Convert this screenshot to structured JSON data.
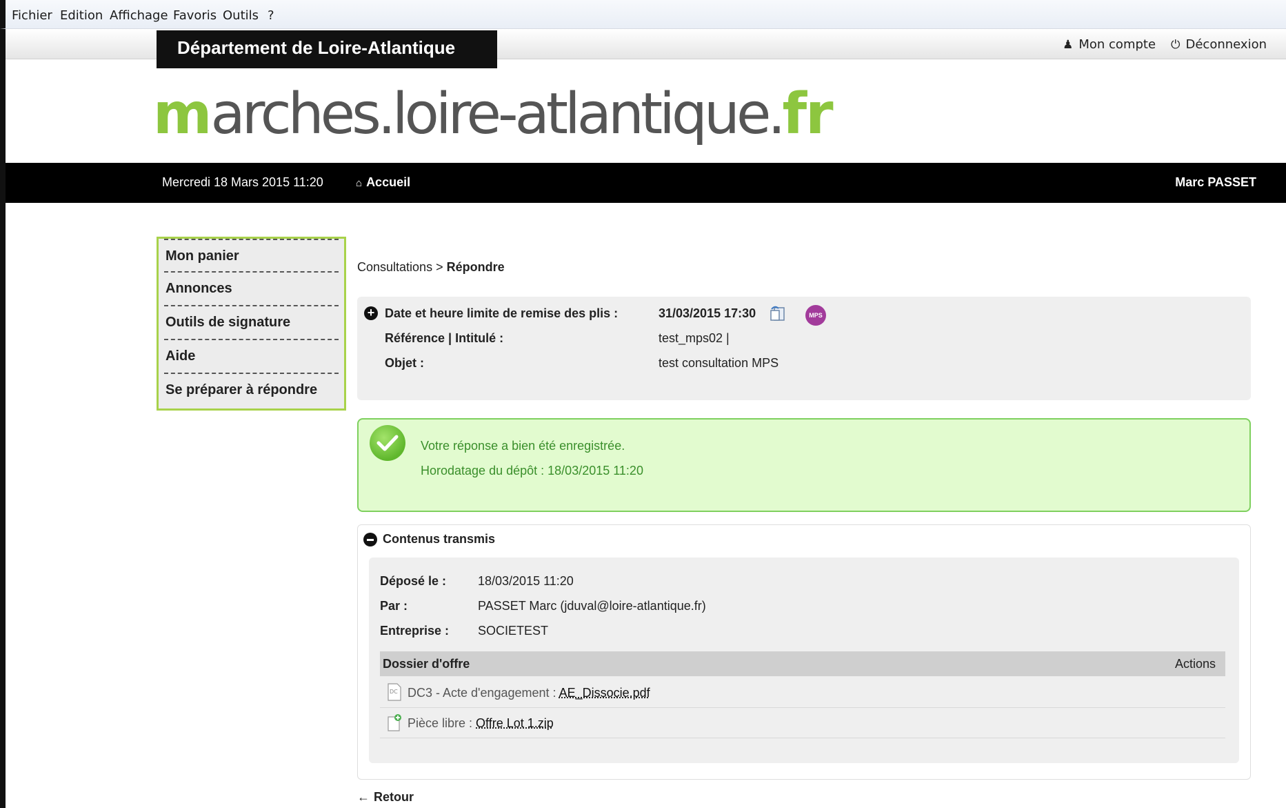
{
  "browser_menu": [
    "Fichier",
    "Edition",
    "Affichage",
    "Favoris",
    "Outils",
    "?"
  ],
  "header": {
    "department": "Département de Loire-Atlantique",
    "account": "Mon compte",
    "logout": "Déconnexion"
  },
  "logo": {
    "m": "m",
    "middle": "arches.loire-atlantique.",
    "fr": "fr"
  },
  "navbar": {
    "date": "Mercredi 18 Mars 2015 11:20",
    "home": "Accueil",
    "user": "Marc PASSET"
  },
  "sidemenu": [
    "Mon panier",
    "Annonces",
    "Outils de signature",
    "Aide",
    "Se préparer à répondre"
  ],
  "breadcrumb": {
    "parent": "Consultations",
    "sep": " > ",
    "current": "Répondre"
  },
  "consultation": {
    "deadline_label": "Date et heure limite de remise des plis :",
    "deadline_value": "31/03/2015 17:30",
    "mps_badge": "MPS",
    "ref_label": "Référence | Intitulé :",
    "ref_value": "test_mps02 |",
    "object_label": "Objet :",
    "object_value": "test consultation MPS"
  },
  "success": {
    "message": "Votre réponse a bien été enregistrée.",
    "timestamp_label": "Horodatage du dépôt :",
    "timestamp_value": "18/03/2015 11:20"
  },
  "contents": {
    "title": "Contenus transmis",
    "deposit_label": "Déposé le :",
    "deposit_value": "18/03/2015 11:20",
    "by_label": "Par :",
    "by_value": "PASSET Marc (jduval@loire-atlantique.fr)",
    "company_label": "Entreprise :",
    "company_value": "SOCIETEST",
    "table_title": "Dossier d'offre",
    "table_actions": "Actions",
    "files": [
      {
        "prefix": "DC3 - Acte d'engagement : ",
        "name": "AE_Dissocie.pdf",
        "icon": "dc-document-icon"
      },
      {
        "prefix": "Pièce libre : ",
        "name": "Offre Lot 1.zip",
        "icon": "add-file-icon"
      }
    ]
  },
  "back": "Retour"
}
